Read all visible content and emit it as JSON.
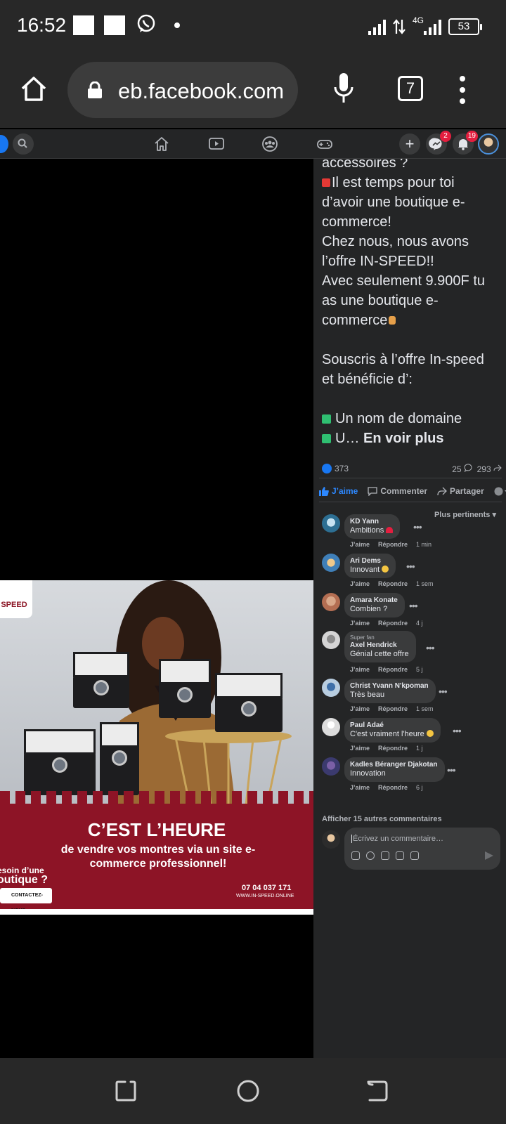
{
  "status_bar": {
    "time": "16:52",
    "network": "4G",
    "battery": "53"
  },
  "browser": {
    "url": "eb.facebook.com",
    "tab_count": "7"
  },
  "fb_nav": {
    "messenger_badge": "2",
    "notifications_badge": "19",
    "create_label": "+"
  },
  "ad": {
    "logo_text": "SPEED",
    "headline": "C’EST L’HEURE",
    "subline": "de vendre vos montres via un site e-commerce professionnel!",
    "need_line1": "esoin d’une",
    "need_line2": "outique ?",
    "contact_label": "CONTACTEZ-NOUS",
    "phone": "07 04 037 171",
    "website": "WWW.IN-SPEED.ONLINE"
  },
  "post": {
    "line_partial": "accessoires ?",
    "para1": "Il est temps pour toi d’avoir une boutique e-commerce!",
    "para2": "Chez nous, nous avons l’offre IN-SPEED!!",
    "para3": "Avec seulement 9.900F tu as une boutique e-commerce",
    "para4": "Souscris à l’offre In-speed et bénéficie d’:",
    "bullet1": "Un nom de domaine",
    "bullet2_partial": "U…",
    "see_more": "En voir plus",
    "reactions_count": "373",
    "comments_count": "25",
    "shares_count": "293",
    "like_label": "J’aime",
    "comment_label": "Commenter",
    "share_label": "Partager",
    "sort_label": "Plus pertinents"
  },
  "comments": [
    {
      "name": "KD Yann",
      "text": "Ambitions",
      "time": "1 min",
      "fan": ""
    },
    {
      "name": "Ari Dems",
      "text": "Innovant",
      "time": "1 sem",
      "fan": ""
    },
    {
      "name": "Amara Konate",
      "text": "Combien ?",
      "time": "4 j",
      "fan": ""
    },
    {
      "name": "Axel Hendrick",
      "text": "Génial cette offre",
      "time": "5 j",
      "fan": "Super fan"
    },
    {
      "name": "Christ Yvann N'kpoman",
      "text": "Très beau",
      "time": "1 sem",
      "fan": ""
    },
    {
      "name": "Paul Adaé",
      "text": "C'est vraiment l'heure",
      "time": "1 j",
      "fan": ""
    },
    {
      "name": "Kadles Béranger Djakotan",
      "text": "Innovation",
      "time": "6 j",
      "fan": ""
    }
  ],
  "comment_actions": {
    "like": "J’aime",
    "reply": "Répondre"
  },
  "more_comments": "Afficher 15 autres commentaires",
  "write_placeholder": "Écrivez un commentaire…",
  "colors": {
    "fb_blue": "#1877f2",
    "panel_bg": "#242526",
    "ad_red": "#8d1426",
    "badge_red": "#e41e3f"
  }
}
